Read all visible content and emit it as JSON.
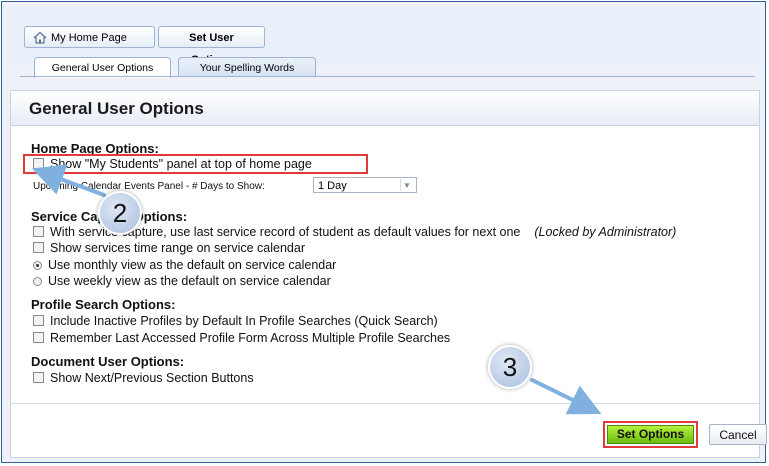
{
  "breadcrumb": {
    "home_label": "My Home Page",
    "current_label": "Set User Options"
  },
  "tabs": [
    {
      "label": "General User Options"
    },
    {
      "label": "Your Spelling Words"
    }
  ],
  "panel": {
    "title": "General User Options"
  },
  "sections": {
    "home": {
      "title": "Home Page Options:",
      "show_students": "Show \"My Students\" panel at top of home page",
      "calendar_label": "Upcoming Calendar Events Panel - # Days to Show:",
      "calendar_value": "1 Day"
    },
    "service": {
      "title": "Service Capture Options:",
      "opt1": "With service capture, use last service record of student as default values for next one",
      "opt1_locked": "(Locked by Administrator)",
      "opt2": "Show services time range on service calendar",
      "opt3": "Use monthly view as the default on service calendar",
      "opt4": "Use weekly view as the default on service calendar"
    },
    "profile": {
      "title": "Profile Search Options:",
      "opt1": "Include Inactive Profiles by Default In Profile Searches (Quick Search)",
      "opt2": "Remember Last Accessed Profile Form Across Multiple Profile Searches"
    },
    "document": {
      "title": "Document User Options:",
      "opt1": "Show Next/Previous Section Buttons"
    }
  },
  "buttons": {
    "set_options": "Set Options",
    "cancel": "Cancel"
  },
  "callouts": {
    "step2": "2",
    "step3": "3"
  },
  "colors": {
    "highlight": "#e03a3a",
    "set_button": "#8fd12a",
    "header_bg": "#eaf0f9"
  }
}
